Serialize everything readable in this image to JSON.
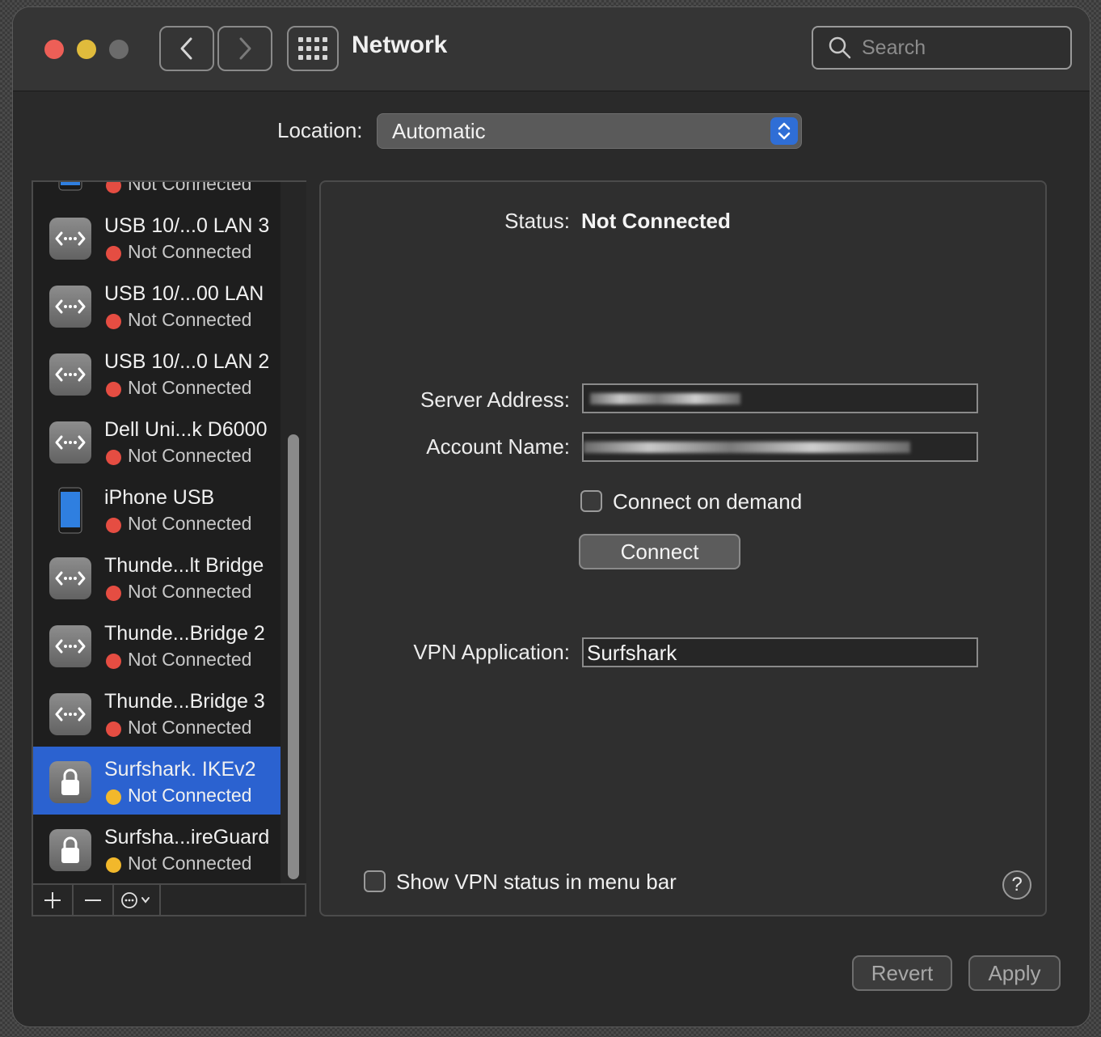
{
  "window": {
    "title": "Network"
  },
  "search": {
    "placeholder": "Search"
  },
  "location": {
    "label": "Location:",
    "value": "Automatic"
  },
  "services": {
    "partial_status": "Not Connected",
    "items": [
      {
        "name": "USB 10/...0 LAN 3",
        "status": "Not Connected",
        "icon": "ethernet-icon",
        "dot": "#e54d42"
      },
      {
        "name": "USB 10/...00 LAN",
        "status": "Not Connected",
        "icon": "ethernet-icon",
        "dot": "#e54d42"
      },
      {
        "name": "USB 10/...0 LAN 2",
        "status": "Not Connected",
        "icon": "ethernet-icon",
        "dot": "#e54d42"
      },
      {
        "name": "Dell Uni...k D6000",
        "status": "Not Connected",
        "icon": "ethernet-icon",
        "dot": "#e54d42"
      },
      {
        "name": "iPhone USB",
        "status": "Not Connected",
        "icon": "iphone-icon",
        "dot": "#e54d42"
      },
      {
        "name": "Thunde...lt Bridge",
        "status": "Not Connected",
        "icon": "ethernet-icon",
        "dot": "#e54d42"
      },
      {
        "name": "Thunde...Bridge 2",
        "status": "Not Connected",
        "icon": "ethernet-icon",
        "dot": "#e54d42"
      },
      {
        "name": "Thunde...Bridge 3",
        "status": "Not Connected",
        "icon": "ethernet-icon",
        "dot": "#e54d42"
      },
      {
        "name": "Surfshark. IKEv2",
        "status": "Not Connected",
        "icon": "lock-icon",
        "dot": "#f2b82b",
        "selected": true
      },
      {
        "name": "Surfsha...ireGuard",
        "status": "Not Connected",
        "icon": "lock-icon",
        "dot": "#f2b82b"
      }
    ]
  },
  "detail": {
    "status_label": "Status:",
    "status_value": "Not Connected",
    "server_label": "Server Address:",
    "account_label": "Account Name:",
    "connect_on_demand_label": "Connect on demand",
    "connect_button": "Connect",
    "vpn_app_label": "VPN Application:",
    "vpn_app_value": "Surfshark",
    "show_vpn_status_label": "Show VPN status in menu bar",
    "help_label": "?"
  },
  "footer": {
    "revert": "Revert",
    "apply": "Apply"
  },
  "colors": {
    "accent": "#2b62d0",
    "status_red": "#e54d42",
    "status_yellow": "#f2b82b"
  }
}
